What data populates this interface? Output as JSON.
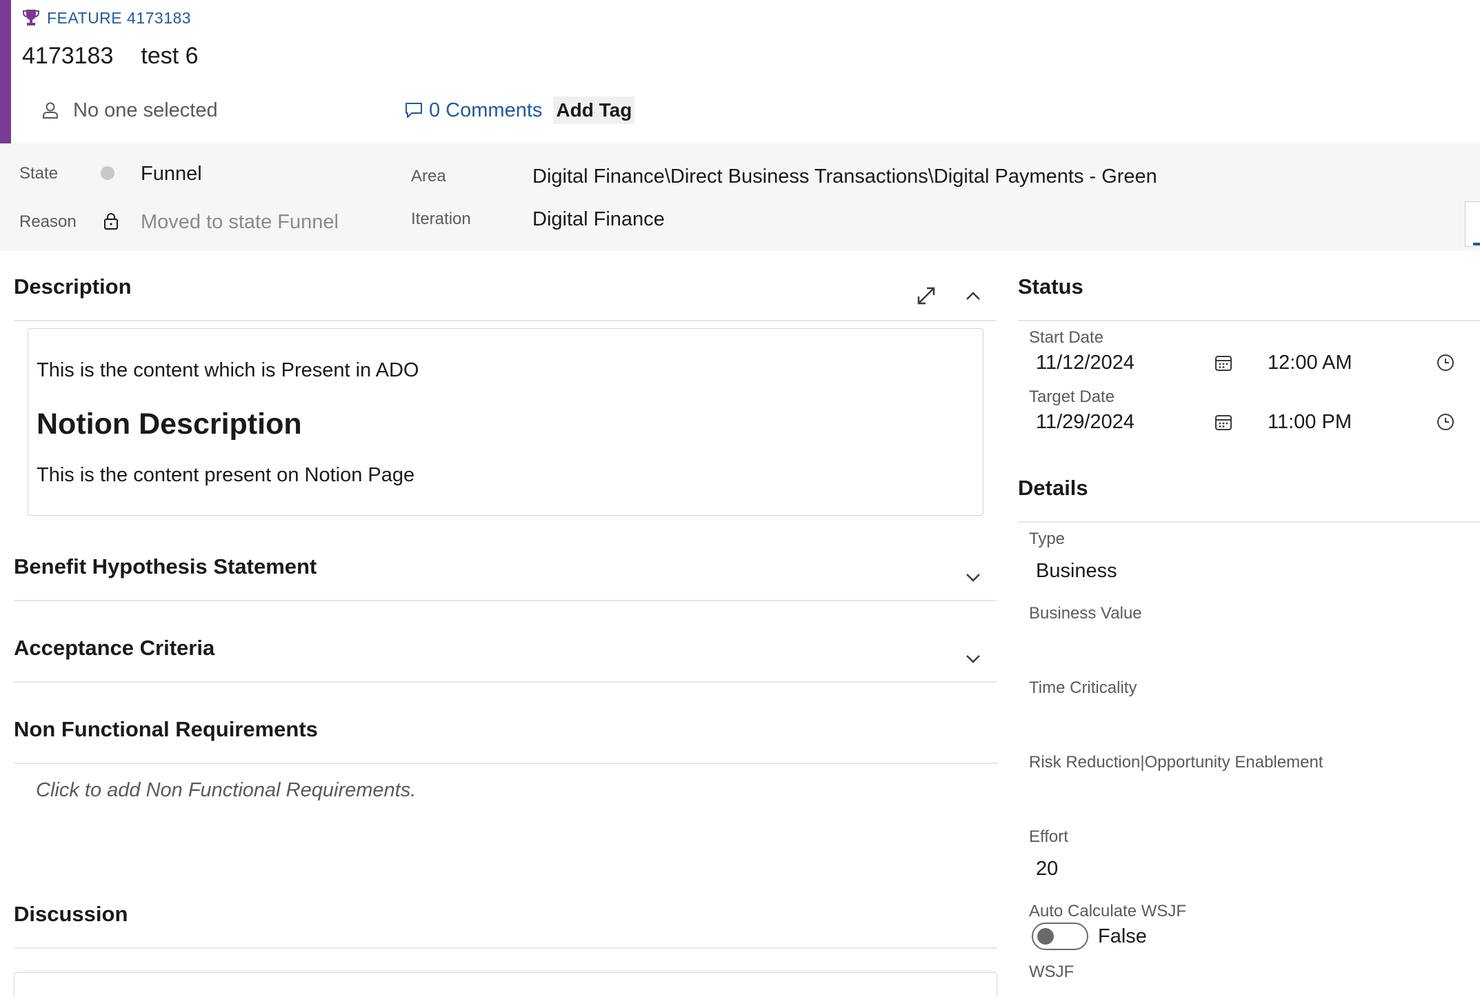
{
  "workitem": {
    "type_label": "FEATURE 4173183",
    "id": "4173183",
    "title": "test 6",
    "assignee": "No one selected",
    "comments_label": "0 Comments",
    "add_tag_label": "Add Tag",
    "accent_color": "#773b93"
  },
  "fields": {
    "state_label": "State",
    "state_value": "Funnel",
    "reason_label": "Reason",
    "reason_value": "Moved to state Funnel",
    "area_label": "Area",
    "area_value": "Digital Finance\\Direct Business Transactions\\Digital Payments - Green",
    "iteration_label": "Iteration",
    "iteration_value": "Digital Finance"
  },
  "left": {
    "description": {
      "title": "Description",
      "para1": "This is the content which is Present in ADO",
      "heading": "Notion Description",
      "para2": "This is the content present on Notion Page"
    },
    "benefit_title": "Benefit Hypothesis Statement",
    "acceptance_title": "Acceptance Criteria",
    "nfr_title": "Non Functional Requirements",
    "nfr_placeholder": "Click to add Non Functional Requirements.",
    "discussion_title": "Discussion"
  },
  "right": {
    "status_title": "Status",
    "start_date_label": "Start Date",
    "start_date": "11/12/2024",
    "start_time": "12:00 AM",
    "target_date_label": "Target Date",
    "target_date": "11/29/2024",
    "target_time": "11:00 PM",
    "details_title": "Details",
    "type_label": "Type",
    "type_value": "Business",
    "business_value_label": "Business Value",
    "time_criticality_label": "Time Criticality",
    "risk_label": "Risk Reduction|Opportunity Enablement",
    "effort_label": "Effort",
    "effort_value": "20",
    "auto_wsjf_label": "Auto Calculate WSJF",
    "auto_wsjf_value": "False",
    "wsjf_label": "WSJF"
  },
  "icons": {
    "trophy": "trophy-icon",
    "person": "person-icon",
    "comment": "comment-icon",
    "lock": "lock-icon",
    "expand": "expand-icon",
    "chevron_up": "chevron-up-icon",
    "chevron_down": "chevron-down-icon",
    "calendar": "calendar-icon",
    "clock": "clock-icon"
  },
  "colors": {
    "link": "#1f5a9e",
    "band": "#f6f6f6"
  }
}
